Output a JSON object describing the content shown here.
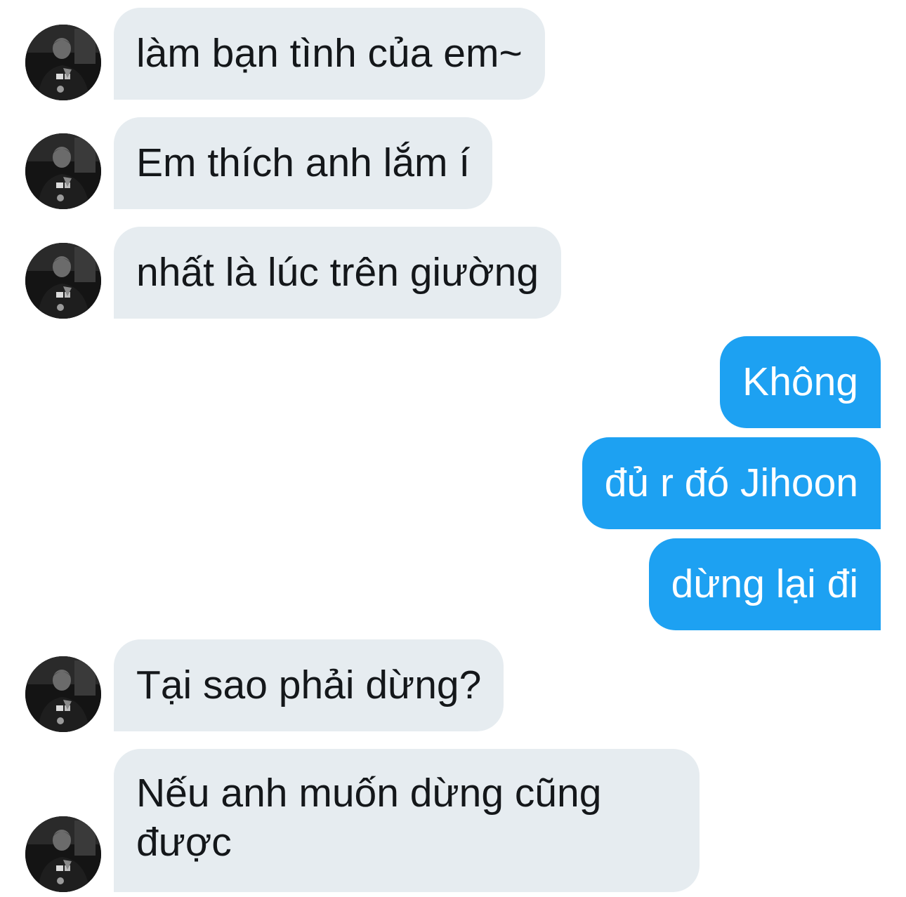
{
  "conversation": {
    "messages": [
      {
        "sender": "them",
        "text": "làm bạn tình của em~"
      },
      {
        "sender": "them",
        "text": "Em thích anh lắm í"
      },
      {
        "sender": "them",
        "text": "nhất là lúc trên giường"
      },
      {
        "sender": "me",
        "text": "Không"
      },
      {
        "sender": "me",
        "text": "đủ r đó Jihoon"
      },
      {
        "sender": "me",
        "text": "dừng lại đi"
      },
      {
        "sender": "them",
        "text": "Tại sao phải dừng?"
      },
      {
        "sender": "them",
        "lines": [
          "Nếu anh muốn dừng cũng",
          "được"
        ]
      }
    ]
  },
  "colors": {
    "incoming_bubble": "#e6ecf0",
    "outgoing_bubble": "#1da1f2",
    "incoming_text": "#14171a",
    "outgoing_text": "#ffffff"
  },
  "icons": {
    "avatar": "contact-avatar-photo"
  }
}
